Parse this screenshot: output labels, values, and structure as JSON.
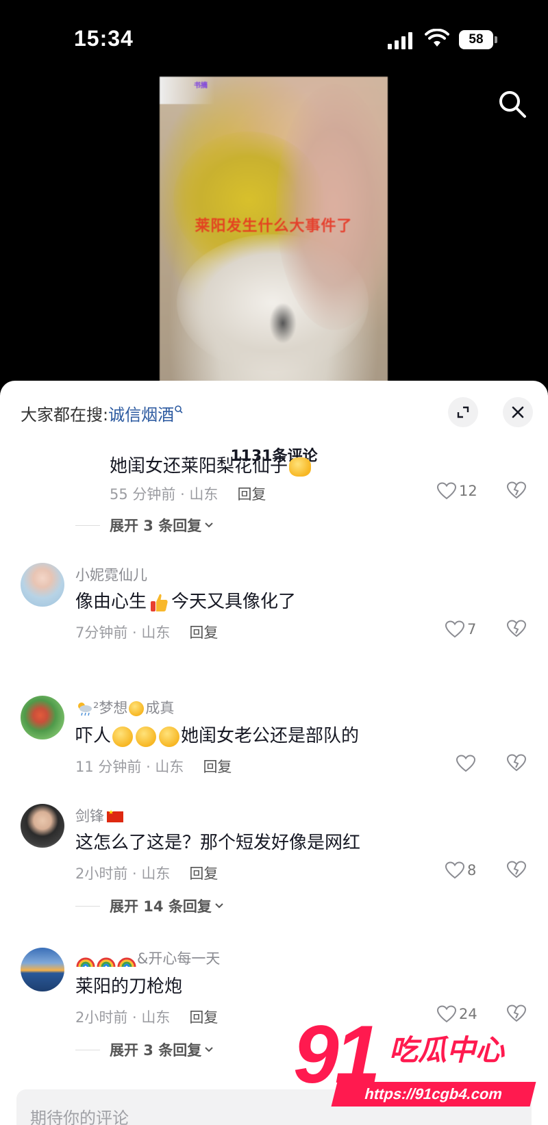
{
  "status_bar": {
    "time": "15:34",
    "battery": "58"
  },
  "video": {
    "overlay_text": "莱阳发生什么大事件了",
    "tag": "书摘"
  },
  "sheet": {
    "hot_search_prefix": "大家都在搜:",
    "hot_search_keyword": "诚信烟酒",
    "comment_count": "1131条评论"
  },
  "comments": [
    {
      "text": "她闺女还莱阳梨花仙子",
      "time_location": "55 分钟前 · 山东",
      "reply_label": "回复",
      "likes": "12",
      "expand": "展开 3 条回复"
    },
    {
      "username": "小妮霓仙儿",
      "text_a": "像由心生",
      "text_b": "今天又具像化了",
      "time_location": "7分钟前 · 山东",
      "reply_label": "回复",
      "likes": "7"
    },
    {
      "username_a": "²梦想",
      "username_b": "成真",
      "text_a": "吓人",
      "text_b": "她闺女老公还是部队的",
      "time_location": "11 分钟前 · 山东",
      "reply_label": "回复",
      "likes": ""
    },
    {
      "username": "剑锋",
      "text": "这怎么了这是？那个短发好像是网红",
      "time_location": "2小时前 · 山东",
      "reply_label": "回复",
      "likes": "8",
      "expand": "展开 14 条回复"
    },
    {
      "username": "&开心每一天",
      "text": "莱阳的刀枪炮",
      "time_location": "2小时前 · 山东",
      "reply_label": "回复",
      "likes": "24",
      "expand": "展开 3 条回复"
    }
  ],
  "input": {
    "placeholder": "期待你的评论"
  },
  "watermark": {
    "number": "91",
    "text": "吃瓜中心",
    "url": "https://91cgb4.com"
  },
  "colors": {
    "accent": "#ff1a4f",
    "keyword": "#2c5aa0"
  }
}
